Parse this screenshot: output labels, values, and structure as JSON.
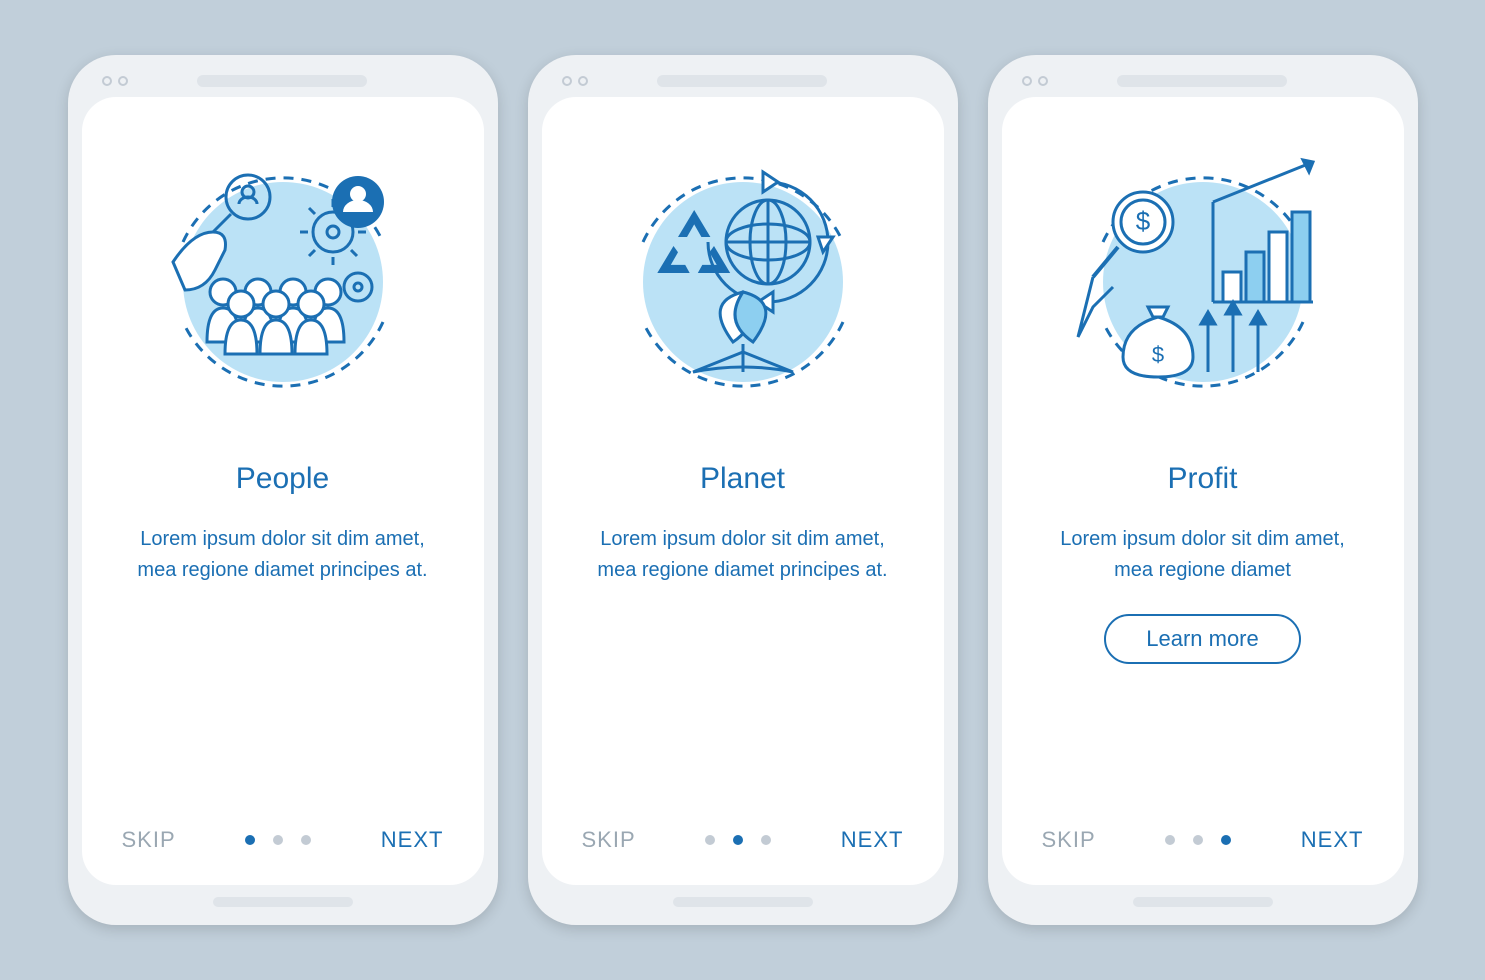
{
  "screens": [
    {
      "title": "People",
      "description": "Lorem ipsum dolor sit dim amet, mea regione diamet principes at.",
      "has_learn_more": false,
      "skip_label": "SKIP",
      "next_label": "NEXT",
      "active_dot": 0,
      "icon": "people-icon"
    },
    {
      "title": "Planet",
      "description": "Lorem ipsum dolor sit dim amet, mea regione diamet principes at.",
      "has_learn_more": false,
      "skip_label": "SKIP",
      "next_label": "NEXT",
      "active_dot": 1,
      "icon": "planet-icon"
    },
    {
      "title": "Profit",
      "description": "Lorem ipsum dolor sit dim amet, mea regione diamet",
      "has_learn_more": true,
      "learn_more_label": "Learn more",
      "skip_label": "SKIP",
      "next_label": "NEXT",
      "active_dot": 2,
      "icon": "profit-icon"
    }
  ],
  "colors": {
    "primary": "#1b6fb3",
    "muted": "#9aa7b2",
    "bg": "#c1cfda",
    "accent_fill": "#8dcff0"
  }
}
